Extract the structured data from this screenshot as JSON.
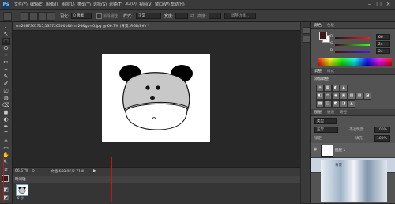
{
  "app": {
    "logo": "Ps"
  },
  "menu": [
    {
      "label": "文件(F)"
    },
    {
      "label": "编辑(E)"
    },
    {
      "label": "图像(I)"
    },
    {
      "label": "图层(L)"
    },
    {
      "label": "类型(Y)"
    },
    {
      "label": "选择(S)"
    },
    {
      "label": "滤镜(T)"
    },
    {
      "label": "3D(D)"
    },
    {
      "label": "视图(V)"
    },
    {
      "label": "窗口(W)"
    },
    {
      "label": "帮助(H)"
    }
  ],
  "window_controls": {
    "minimize": "–",
    "maximize": "□",
    "close": "×"
  },
  "options": {
    "feather_label": "羽化:",
    "feather_value": "0 像素",
    "antialias_label": "消除锯齿",
    "style_label": "样式:",
    "style_value": "正常",
    "width_label": "宽度:",
    "height_label": "高度:",
    "refine_edge": "调整边缘..."
  },
  "document": {
    "tab_title": "u=2087361715,1337265001&fm=26&gp=0.jpg @ 66.7% (背景, RGB/8#) *",
    "zoom": "66.67%",
    "doc_size": "文档:669.0K/2.71M"
  },
  "timeline": {
    "label": "时间轴",
    "frame_delay": "0 秒"
  },
  "color_panel": {
    "tabs": [
      "颜色",
      "色板"
    ],
    "channels": [
      {
        "label": "R",
        "value": "60"
      },
      {
        "label": "G",
        "value": "24"
      },
      {
        "label": "B",
        "value": "24"
      }
    ],
    "fg_color": "#3c1818",
    "bg_color": "#ffffff"
  },
  "adjust_panel": {
    "tabs": [
      "调整",
      "样式"
    ],
    "title": "添加调整",
    "icons": [
      "☀",
      "▦",
      "◐",
      "▲",
      "◧",
      "⚖",
      "◉",
      "▣",
      "▧",
      "▨",
      "◪",
      "▩",
      "◫",
      "◩",
      "◨",
      "◭"
    ]
  },
  "layers_panel": {
    "tabs": [
      "图层",
      "通道",
      "路径"
    ],
    "kind_label": "类型",
    "blend": "正常",
    "opacity_label": "不透明度:",
    "opacity": "100%",
    "lock_label": "锁定:",
    "fill_label": "填充:",
    "fill": "100%",
    "layers": [
      {
        "name": "图层 1"
      },
      {
        "name": "背景"
      }
    ]
  },
  "tools": [
    "▸",
    "⬚",
    "ⵔ",
    "✧",
    "✂",
    "⌖",
    "✎",
    "⎚",
    "✐",
    "◍",
    "⌫",
    "◼",
    "◐",
    "⌂",
    "✒",
    "T",
    "↖",
    "▭",
    "✋",
    "🔍",
    "◩",
    "⇄"
  ]
}
